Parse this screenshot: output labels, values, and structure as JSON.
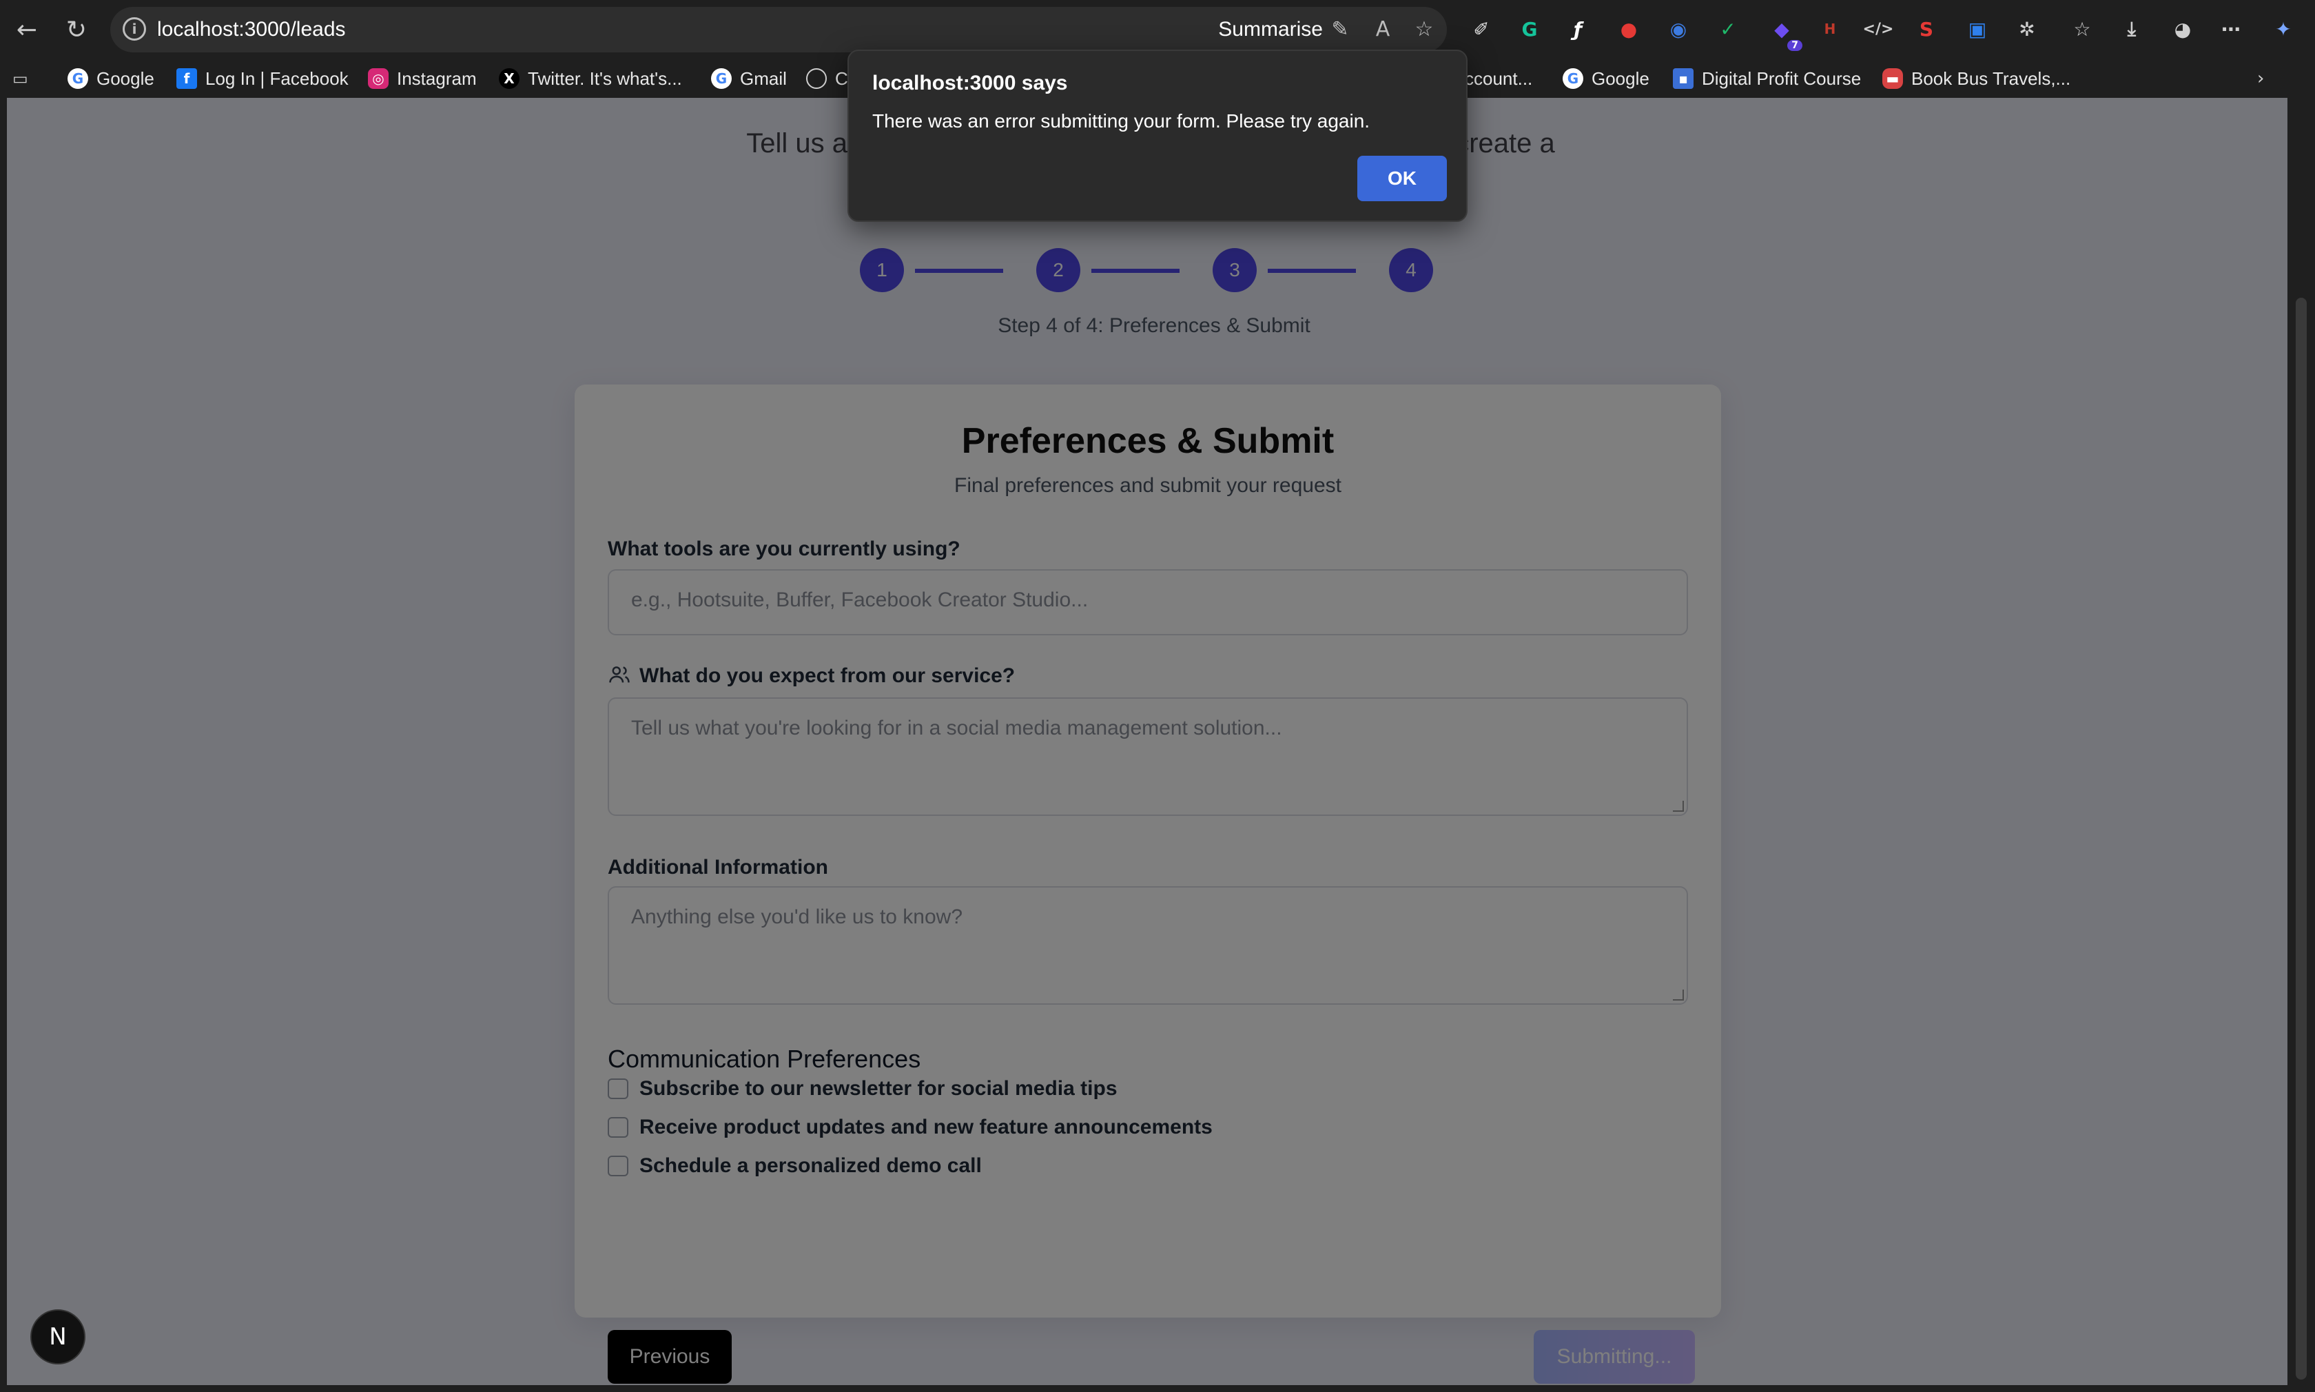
{
  "browser": {
    "url": "localhost:3000/leads",
    "summarise_label": "Summarise",
    "bookmarks": [
      {
        "label": "Google",
        "icon": "google-icon"
      },
      {
        "label": "Log In | Facebook",
        "icon": "facebook-icon"
      },
      {
        "label": "Instagram",
        "icon": "instagram-icon"
      },
      {
        "label": "Twitter. It's what's...",
        "icon": "x-icon"
      },
      {
        "label": "Gmail",
        "icon": "google-icon"
      },
      {
        "label": "C",
        "icon": "globe-icon"
      },
      {
        "label": "ccount...",
        "icon": ""
      },
      {
        "label": "Google",
        "icon": "google-icon"
      },
      {
        "label": "Digital Profit Course",
        "icon": "course-icon"
      },
      {
        "label": "Book Bus Travels,...",
        "icon": "bus-icon"
      }
    ],
    "extension_badge": "7"
  },
  "page": {
    "intro_left": "Tell us ab",
    "intro_right": "create a",
    "steps": [
      "1",
      "2",
      "3",
      "4"
    ],
    "step_caption": "Step 4 of 4: Preferences & Submit",
    "card": {
      "title": "Preferences & Submit",
      "subtitle": "Final preferences and submit your request",
      "tools_label": "What tools are you currently using?",
      "tools_placeholder": "e.g., Hootsuite, Buffer, Facebook Creator Studio...",
      "expect_label": "What do you expect from our service?",
      "expect_placeholder": "Tell us what you're looking for in a social media management solution...",
      "additional_label": "Additional Information",
      "additional_placeholder": "Anything else you'd like us to know?",
      "comm_title": "Communication Preferences",
      "checkboxes": [
        "Subscribe to our newsletter for social media tips",
        "Receive product updates and new feature announcements",
        "Schedule a personalized demo call"
      ],
      "previous_label": "Previous",
      "submit_label": "Submitting..."
    },
    "next_badge": "N"
  },
  "dialog": {
    "title": "localhost:3000 says",
    "message": "There was an error submitting your form. Please try again.",
    "ok_label": "OK"
  },
  "colors": {
    "accent": "#4f46e5",
    "dialog_button": "#3a68d8",
    "chrome_bg": "#1f1f1f"
  }
}
